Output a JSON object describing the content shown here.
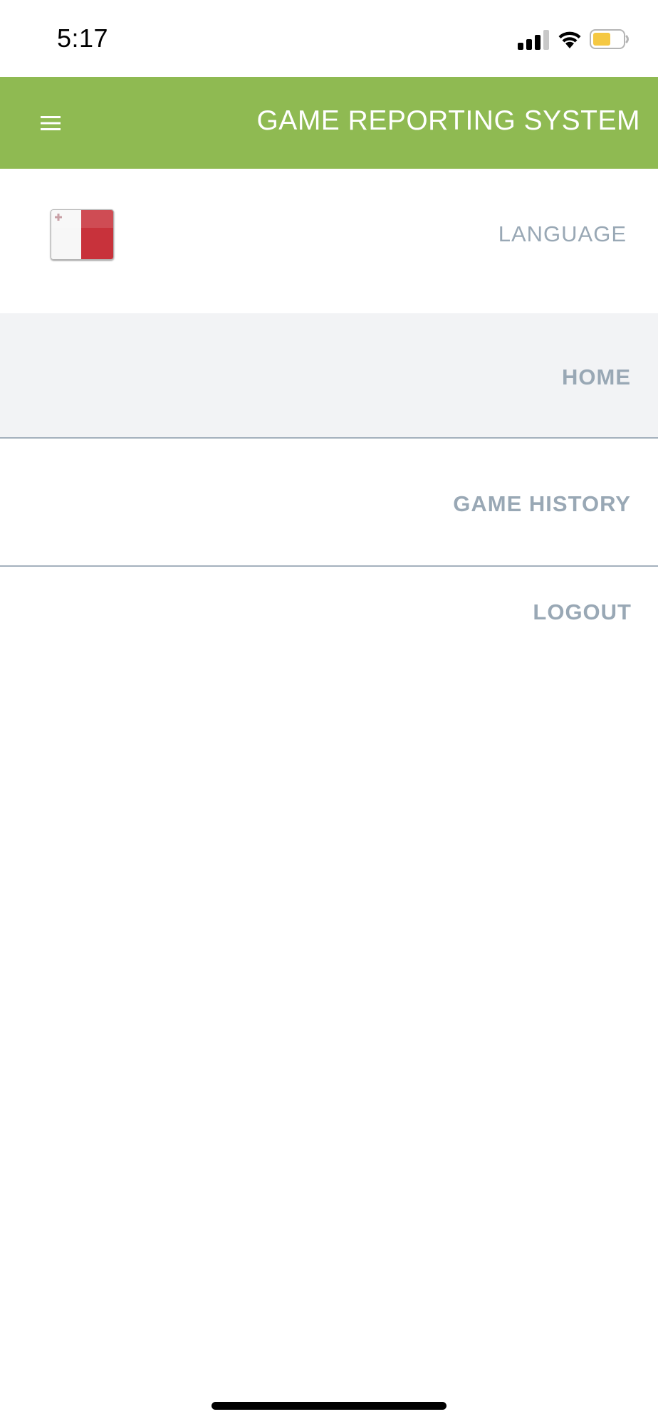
{
  "status_bar": {
    "time": "5:17",
    "battery_color": "#f5c842"
  },
  "header": {
    "title": "GAME REPORTING SYSTEM",
    "menu_icon": "hamburger-menu-icon",
    "background_color": "#8fba52"
  },
  "language": {
    "label": "LANGUAGE",
    "flag": "malta-flag"
  },
  "nav": {
    "items": [
      {
        "label": "HOME",
        "active": true
      },
      {
        "label": "GAME HISTORY",
        "active": false
      },
      {
        "label": "LOGOUT",
        "active": false
      }
    ]
  }
}
